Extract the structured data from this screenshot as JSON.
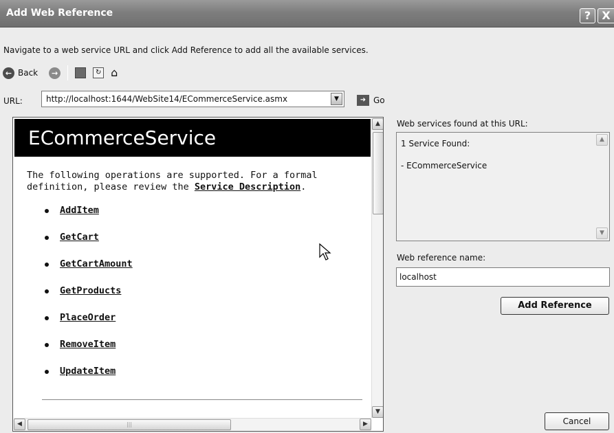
{
  "window": {
    "title": "Add Web Reference",
    "help_label": "?",
    "close_label": "X"
  },
  "description": "Navigate to a web service URL and click Add Reference to add all the available services.",
  "toolbar": {
    "back_label": "Back",
    "icons": [
      "back-icon",
      "forward-icon",
      "stop-icon",
      "refresh-icon",
      "home-icon"
    ]
  },
  "url_bar": {
    "label": "URL:",
    "value": "http://localhost:1644/WebSite14/ECommerceService.asmx",
    "go_label": "Go"
  },
  "browser": {
    "heading": "ECommerceService",
    "intro_text": "The following operations are supported. For a formal definition, please review the ",
    "service_description_link": "Service Description",
    "intro_end": ".",
    "operations": [
      "AddItem",
      "GetCart",
      "GetCartAmount",
      "GetProducts",
      "PlaceOrder",
      "RemoveItem",
      "UpdateItem"
    ]
  },
  "side_panel": {
    "found_label": "Web services found at this URL:",
    "found_count": "1 Service Found:",
    "found_item": "- ECommerceService",
    "ref_name_label": "Web reference name:",
    "ref_name_value": "localhost",
    "add_reference_label": "Add Reference",
    "cancel_label": "Cancel"
  },
  "colors": {
    "titlebar": "#7e7e7e",
    "header_bg": "#000000",
    "dialog_bg": "#ececec"
  }
}
